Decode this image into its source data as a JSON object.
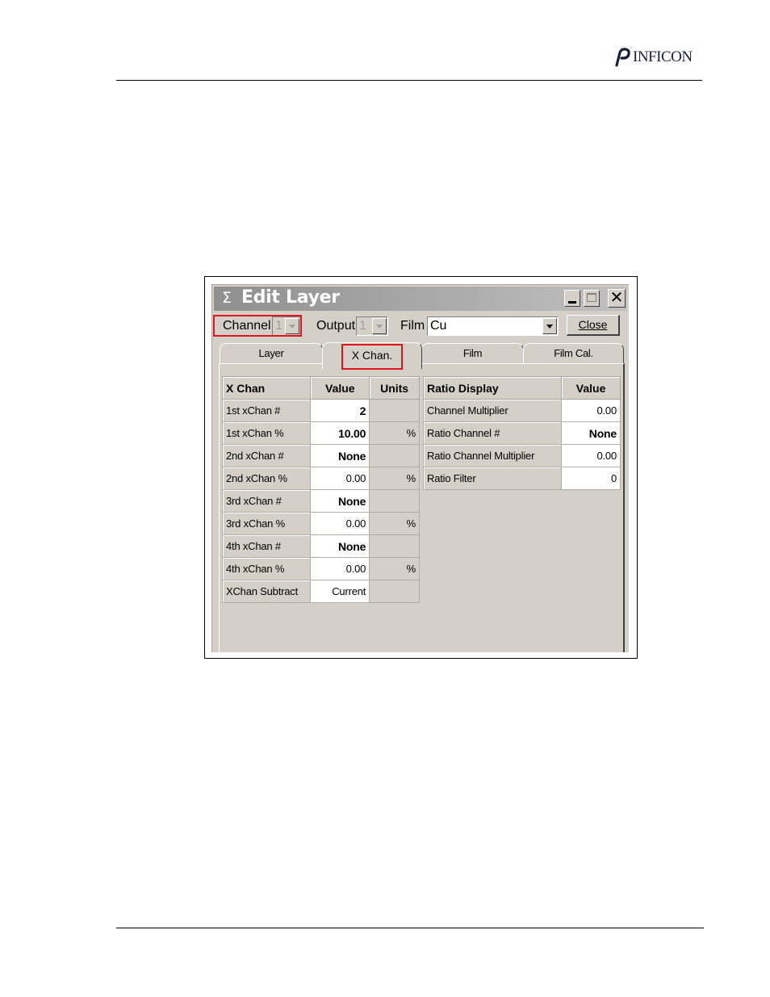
{
  "header": {
    "logo_text": "INFICON"
  },
  "window": {
    "title_icon": "sigma-icon",
    "title": "Edit Layer",
    "title_sigma": "Σ"
  },
  "toolbar": {
    "channel_label": "Channel",
    "channel_value": "1",
    "output_label": "Output",
    "output_value": "1",
    "film_label": "Film",
    "film_value": "Cu",
    "close_label": "Close"
  },
  "tabs": [
    {
      "label": "Layer"
    },
    {
      "label": "X Chan."
    },
    {
      "label": "Film"
    },
    {
      "label": "Film Cal."
    }
  ],
  "active_tab": "X Chan.",
  "xchan_table": {
    "headers": [
      "X Chan",
      "Value",
      "Units"
    ],
    "rows": [
      {
        "label": "1st xChan #",
        "value": "2",
        "units": ""
      },
      {
        "label": "1st xChan %",
        "value": "10.00",
        "units": "%"
      },
      {
        "label": "2nd xChan #",
        "value": "None",
        "units": ""
      },
      {
        "label": "2nd xChan %",
        "value": "0.00",
        "units": "%"
      },
      {
        "label": "3rd xChan #",
        "value": "None",
        "units": ""
      },
      {
        "label": "3rd xChan %",
        "value": "0.00",
        "units": "%"
      },
      {
        "label": "4th xChan #",
        "value": "None",
        "units": ""
      },
      {
        "label": "4th xChan %",
        "value": "0.00",
        "units": "%"
      },
      {
        "label": "XChan Subtract",
        "value": "Current",
        "units": ""
      }
    ]
  },
  "ratio_table": {
    "headers": [
      "Ratio Display",
      "Value"
    ],
    "rows": [
      {
        "label": "Channel Multiplier",
        "value": "0.00"
      },
      {
        "label": "Ratio Channel #",
        "value": "None"
      },
      {
        "label": "Ratio Channel Multiplier",
        "value": "0.00"
      },
      {
        "label": "Ratio Filter",
        "value": "0"
      }
    ]
  },
  "colors": {
    "highlight": "#e0141e",
    "window_face": "#d4d0c8",
    "titlebar_inactive": "#a3a3a3"
  }
}
